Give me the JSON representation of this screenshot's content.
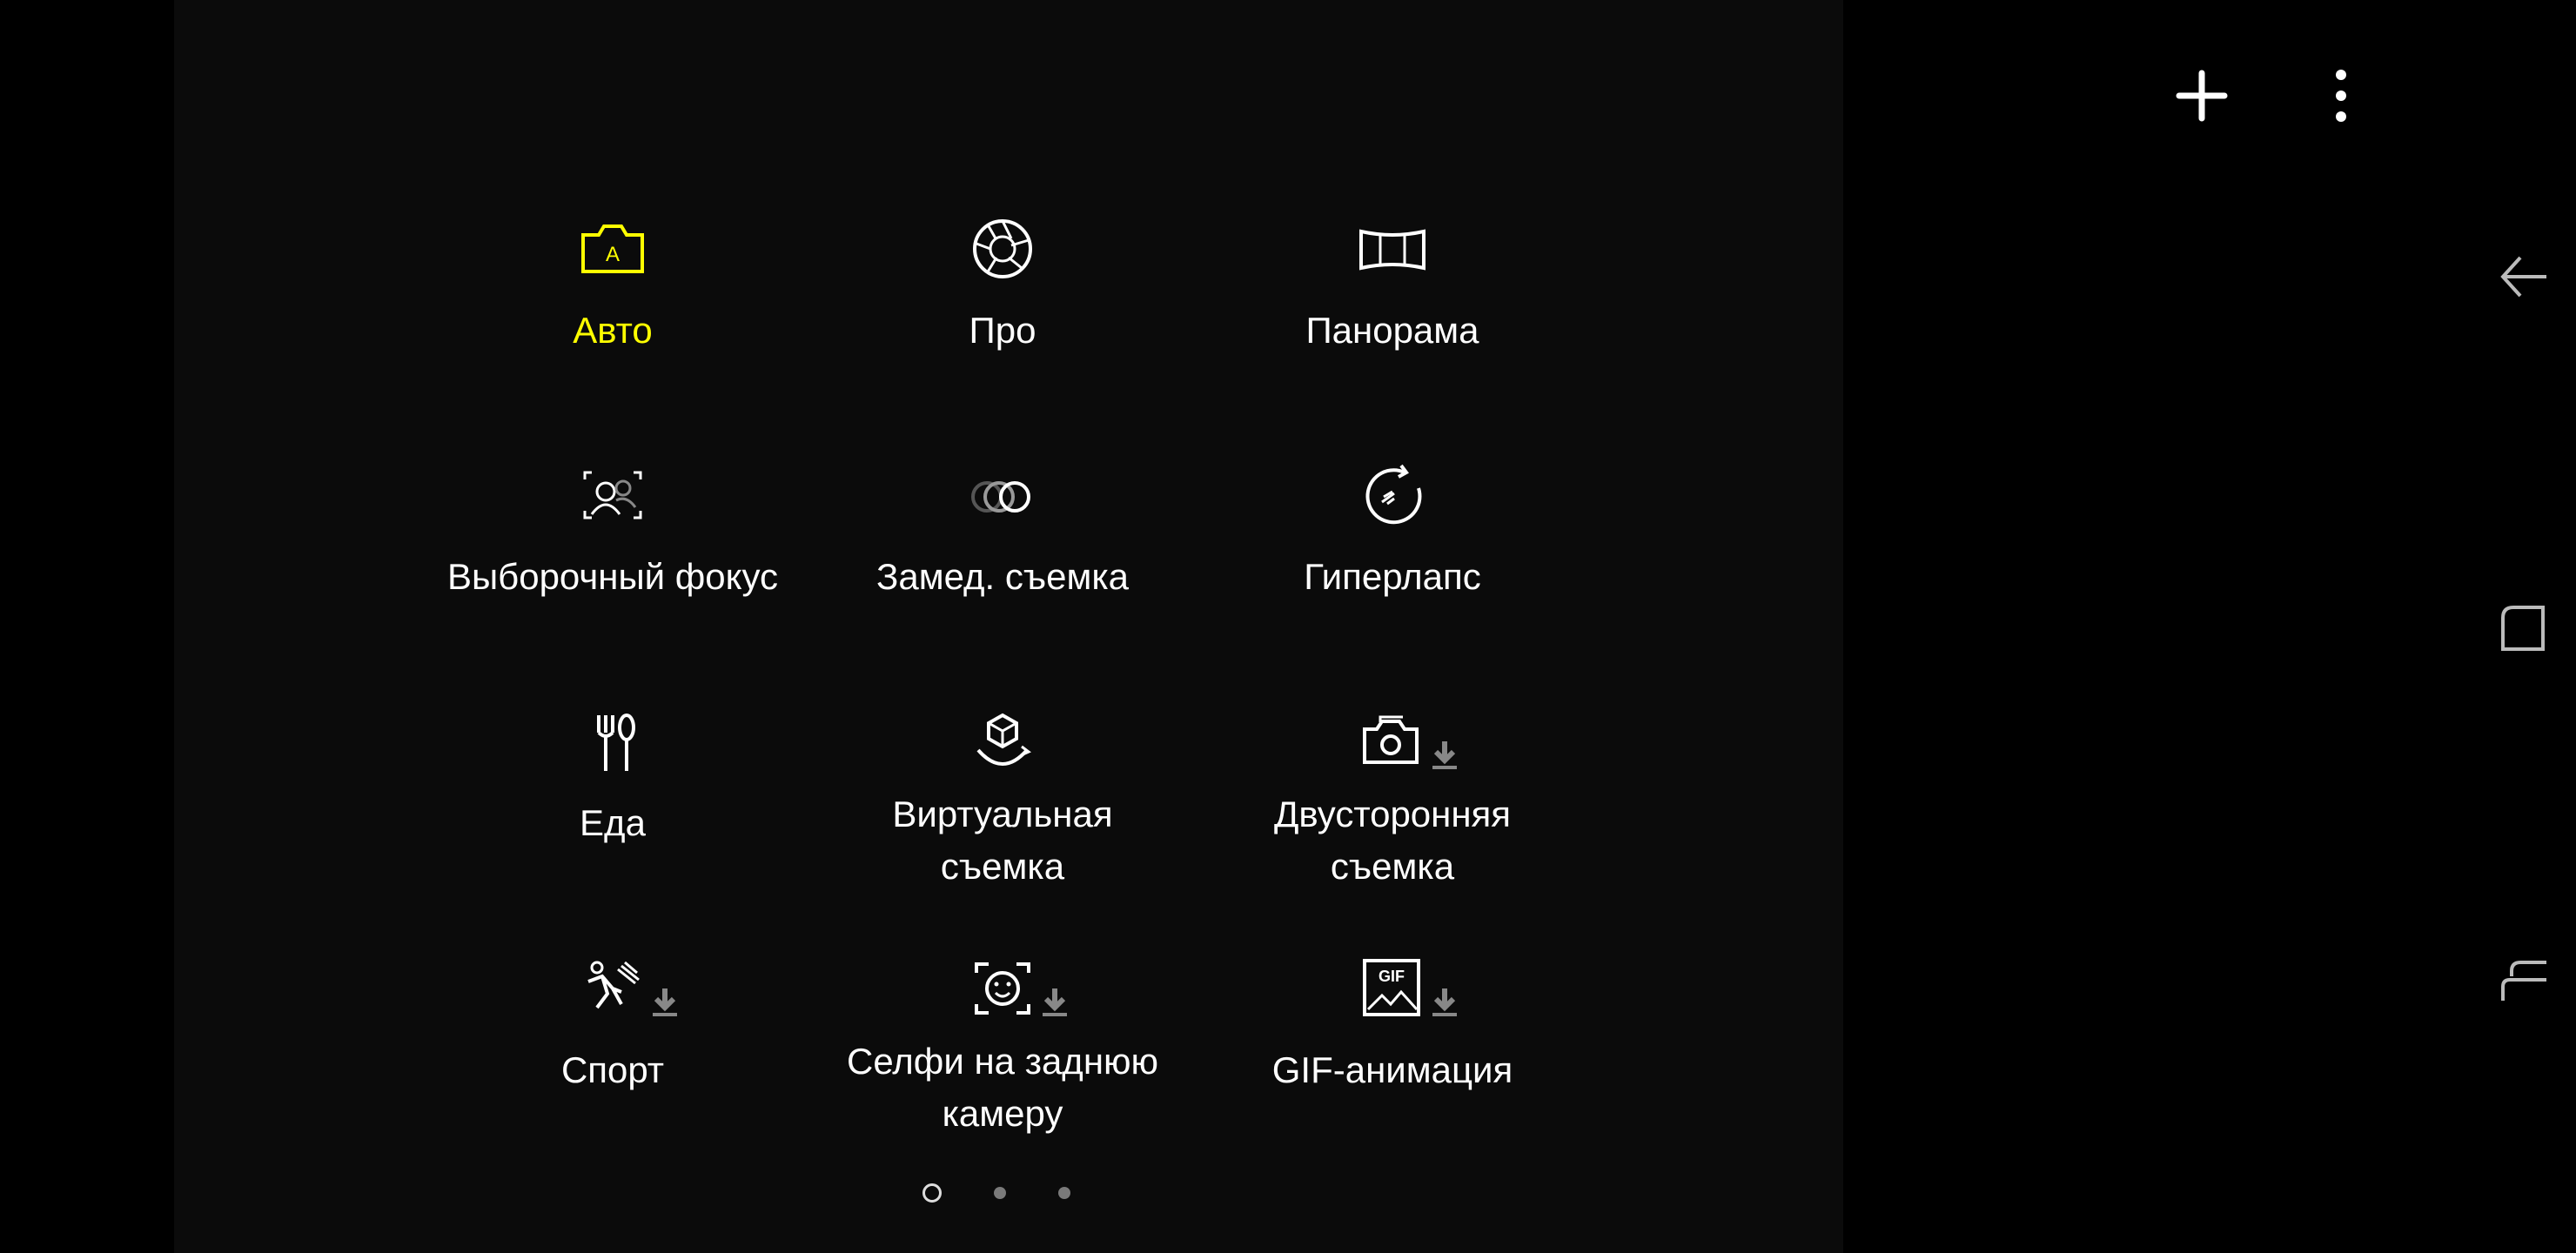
{
  "toolbar": {
    "add_icon": "plus-icon",
    "more_icon": "more-vert-icon"
  },
  "modes": [
    {
      "label": "Авто",
      "icon": "camera-auto-icon",
      "active": true,
      "download": false
    },
    {
      "label": "Про",
      "icon": "aperture-icon",
      "active": false,
      "download": false
    },
    {
      "label": "Панорама",
      "icon": "panorama-icon",
      "active": false,
      "download": false
    },
    {
      "label": "Выборочный фокус",
      "icon": "selective-focus-icon",
      "active": false,
      "download": false
    },
    {
      "label": "Замед. съемка",
      "icon": "slow-motion-icon",
      "active": false,
      "download": false
    },
    {
      "label": "Гиперлапс",
      "icon": "hyperlapse-icon",
      "active": false,
      "download": false
    },
    {
      "label": "Еда",
      "icon": "food-icon",
      "active": false,
      "download": false
    },
    {
      "label": "Виртуальная съемка",
      "line1": "Виртуальная",
      "line2": "съемка",
      "icon": "virtual-shot-icon",
      "active": false,
      "download": false
    },
    {
      "label": "Двусторонняя съемка",
      "line1": "Двусторонняя",
      "line2": "съемка",
      "icon": "dual-camera-icon",
      "active": false,
      "download": true
    },
    {
      "label": "Спорт",
      "icon": "sport-icon",
      "active": false,
      "download": true
    },
    {
      "label": "Селфи на заднюю камеру",
      "line1": "Селфи на заднюю",
      "line2": "камеру",
      "icon": "rear-selfie-icon",
      "active": false,
      "download": true
    },
    {
      "label": "GIF-анимация",
      "icon": "gif-icon",
      "icon_text": "GIF",
      "active": false,
      "download": true
    }
  ],
  "pager": {
    "pages": 3,
    "current": 1
  },
  "nav": {
    "back_icon": "back-icon",
    "home_icon": "home-icon",
    "recents_icon": "recents-icon"
  },
  "colors": {
    "active": "#ffff00",
    "text": "#ffffff",
    "background": "#000000"
  }
}
